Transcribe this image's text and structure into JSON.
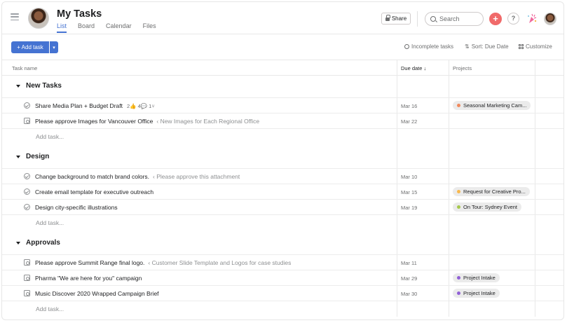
{
  "header": {
    "title": "My Tasks",
    "tabs": [
      {
        "label": "List",
        "active": true
      },
      {
        "label": "Board",
        "active": false
      },
      {
        "label": "Calendar",
        "active": false
      },
      {
        "label": "Files",
        "active": false
      }
    ],
    "share_label": "Share",
    "search_placeholder": "Search",
    "plus_icon": "+",
    "help_icon": "?"
  },
  "toolbar": {
    "add_task_label": "+ Add task",
    "incomplete_label": "Incomplete tasks",
    "sort_label": "Sort: Due Date",
    "customize_label": "Customize"
  },
  "columns": {
    "name": "Task name",
    "due": "Due date ↓",
    "projects": "Projects"
  },
  "add_task_text": "Add task...",
  "colors": {
    "accent": "#4573d2",
    "orange_dot": "#f1895c",
    "yellow_dot": "#f8b84e",
    "green_dot": "#a6c94d",
    "purple_dot": "#9060d6"
  },
  "sections": [
    {
      "title": "New Tasks",
      "tasks": [
        {
          "icon": "check-circle-icon",
          "name": "Share Media Plan + Budget Draft",
          "parent": "",
          "meta": "2👍 4💬 1⑂",
          "due": "Mar 16",
          "project": "Seasonal Marketing Cam...",
          "dot": "#f1895c"
        },
        {
          "icon": "approval-icon",
          "name": "Please approve Images for Vancouver Office",
          "parent": "‹ New Images for Each Regional Office",
          "meta": "",
          "due": "Mar 22",
          "project": "",
          "dot": ""
        }
      ]
    },
    {
      "title": "Design",
      "tasks": [
        {
          "icon": "check-circle-icon",
          "name": "Change background to match brand colors.",
          "parent": "‹ Please approve this attachment",
          "meta": "",
          "due": "Mar 10",
          "project": "",
          "dot": ""
        },
        {
          "icon": "check-circle-icon",
          "name": "Create email template for executive outreach",
          "parent": "",
          "meta": "",
          "due": "Mar 15",
          "project": "Request for Creative Pro...",
          "dot": "#f8b84e"
        },
        {
          "icon": "check-circle-icon",
          "name": "Design city-specific illustrations",
          "parent": "",
          "meta": "",
          "due": "Mar 19",
          "project": "On Tour: Sydney Event",
          "dot": "#a6c94d"
        }
      ]
    },
    {
      "title": "Approvals",
      "tasks": [
        {
          "icon": "approval-icon",
          "name": "Please approve Summit Range final logo.",
          "parent": "‹ Customer Slide Template and Logos for case studies",
          "meta": "",
          "due": "Mar 11",
          "project": "",
          "dot": ""
        },
        {
          "icon": "approval-icon",
          "name": "Pharma \"We are here for you\" campaign",
          "parent": "",
          "meta": "",
          "due": "Mar 29",
          "project": "Project Intake",
          "dot": "#9060d6"
        },
        {
          "icon": "approval-icon",
          "name": "Music Discover 2020 Wrapped Campaign Brief",
          "parent": "",
          "meta": "",
          "due": "Mar 30",
          "project": "Project Intake",
          "dot": "#9060d6"
        }
      ]
    }
  ]
}
